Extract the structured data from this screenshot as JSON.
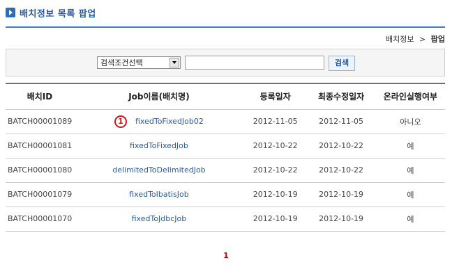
{
  "page": {
    "title": "배치정보 목록 팝업"
  },
  "breadcrumb": {
    "parent": "배치정보",
    "separator": ">",
    "current": "팝업"
  },
  "search": {
    "select_value": "검색조건선택",
    "input_value": "",
    "button_label": "검색"
  },
  "table": {
    "headers": {
      "id": "배치ID",
      "job": "Job이름(배치명)",
      "registered": "등록일자",
      "modified": "최종수정일자",
      "online": "온라인실행여부"
    },
    "rows": [
      {
        "id": "BATCH00001089",
        "job": "fixedToFixedJob02",
        "registered": "2012-11-05",
        "modified": "2012-11-05",
        "online": "아니오",
        "marker": "1"
      },
      {
        "id": "BATCH00001081",
        "job": "fixedToFixedJob",
        "registered": "2012-10-22",
        "modified": "2012-10-22",
        "online": "예"
      },
      {
        "id": "BATCH00001080",
        "job": "delimitedToDelimitedJob",
        "registered": "2012-10-22",
        "modified": "2012-10-22",
        "online": "예"
      },
      {
        "id": "BATCH00001079",
        "job": "fixedToIbatisJob",
        "registered": "2012-10-19",
        "modified": "2012-10-19",
        "online": "예"
      },
      {
        "id": "BATCH00001070",
        "job": "fixedToJdbcJob",
        "registered": "2012-10-19",
        "modified": "2012-10-19",
        "online": "예"
      }
    ]
  },
  "pagination": {
    "current_page": "1"
  },
  "icons": {
    "title_icon": "arrow-right-icon",
    "select_icon": "chevron-down-icon"
  },
  "colors": {
    "accent": "#2a5aa0",
    "title_line": "#3c7dc4",
    "marker": "#d01616",
    "page_link": "#c00000"
  }
}
